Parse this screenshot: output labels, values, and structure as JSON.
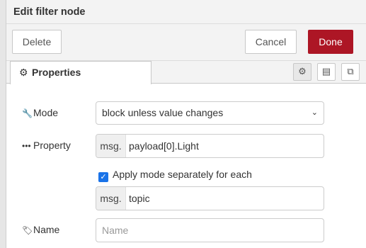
{
  "dialog": {
    "title": "Edit filter node"
  },
  "toolbar": {
    "delete_label": "Delete",
    "cancel_label": "Cancel",
    "done_label": "Done"
  },
  "tabs": [
    {
      "label": "Properties",
      "icon": "gear-icon"
    }
  ],
  "tab_buttons": [
    {
      "icon": "gear-icon",
      "glyph": "⚙"
    },
    {
      "icon": "document-icon",
      "glyph": "▤"
    },
    {
      "icon": "frame-icon",
      "glyph": "⧉"
    }
  ],
  "form": {
    "mode": {
      "label": "Mode",
      "icon": "wrench-icon",
      "value": "block unless value changes"
    },
    "property": {
      "label": "Property",
      "icon": "ellipsis-icon",
      "prefix": "msg.",
      "value": "payload[0].Light"
    },
    "apply_separately": {
      "label": "Apply mode separately for each",
      "checked": true
    },
    "topic": {
      "prefix": "msg.",
      "value": "topic"
    },
    "name": {
      "label": "Name",
      "icon": "tag-icon",
      "placeholder": "Name"
    }
  },
  "colors": {
    "done_button": "#ad1625",
    "checkbox": "#1a73e8"
  }
}
